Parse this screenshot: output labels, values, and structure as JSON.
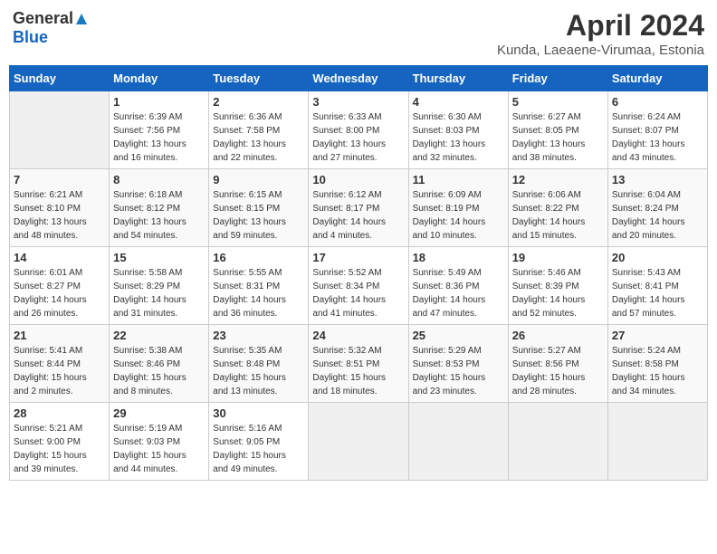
{
  "header": {
    "logo_general": "General",
    "logo_blue": "Blue",
    "month": "April 2024",
    "location": "Kunda, Laeaene-Virumaa, Estonia"
  },
  "days_of_week": [
    "Sunday",
    "Monday",
    "Tuesday",
    "Wednesday",
    "Thursday",
    "Friday",
    "Saturday"
  ],
  "weeks": [
    [
      {
        "day": "",
        "info": ""
      },
      {
        "day": "1",
        "info": "Sunrise: 6:39 AM\nSunset: 7:56 PM\nDaylight: 13 hours\nand 16 minutes."
      },
      {
        "day": "2",
        "info": "Sunrise: 6:36 AM\nSunset: 7:58 PM\nDaylight: 13 hours\nand 22 minutes."
      },
      {
        "day": "3",
        "info": "Sunrise: 6:33 AM\nSunset: 8:00 PM\nDaylight: 13 hours\nand 27 minutes."
      },
      {
        "day": "4",
        "info": "Sunrise: 6:30 AM\nSunset: 8:03 PM\nDaylight: 13 hours\nand 32 minutes."
      },
      {
        "day": "5",
        "info": "Sunrise: 6:27 AM\nSunset: 8:05 PM\nDaylight: 13 hours\nand 38 minutes."
      },
      {
        "day": "6",
        "info": "Sunrise: 6:24 AM\nSunset: 8:07 PM\nDaylight: 13 hours\nand 43 minutes."
      }
    ],
    [
      {
        "day": "7",
        "info": "Sunrise: 6:21 AM\nSunset: 8:10 PM\nDaylight: 13 hours\nand 48 minutes."
      },
      {
        "day": "8",
        "info": "Sunrise: 6:18 AM\nSunset: 8:12 PM\nDaylight: 13 hours\nand 54 minutes."
      },
      {
        "day": "9",
        "info": "Sunrise: 6:15 AM\nSunset: 8:15 PM\nDaylight: 13 hours\nand 59 minutes."
      },
      {
        "day": "10",
        "info": "Sunrise: 6:12 AM\nSunset: 8:17 PM\nDaylight: 14 hours\nand 4 minutes."
      },
      {
        "day": "11",
        "info": "Sunrise: 6:09 AM\nSunset: 8:19 PM\nDaylight: 14 hours\nand 10 minutes."
      },
      {
        "day": "12",
        "info": "Sunrise: 6:06 AM\nSunset: 8:22 PM\nDaylight: 14 hours\nand 15 minutes."
      },
      {
        "day": "13",
        "info": "Sunrise: 6:04 AM\nSunset: 8:24 PM\nDaylight: 14 hours\nand 20 minutes."
      }
    ],
    [
      {
        "day": "14",
        "info": "Sunrise: 6:01 AM\nSunset: 8:27 PM\nDaylight: 14 hours\nand 26 minutes."
      },
      {
        "day": "15",
        "info": "Sunrise: 5:58 AM\nSunset: 8:29 PM\nDaylight: 14 hours\nand 31 minutes."
      },
      {
        "day": "16",
        "info": "Sunrise: 5:55 AM\nSunset: 8:31 PM\nDaylight: 14 hours\nand 36 minutes."
      },
      {
        "day": "17",
        "info": "Sunrise: 5:52 AM\nSunset: 8:34 PM\nDaylight: 14 hours\nand 41 minutes."
      },
      {
        "day": "18",
        "info": "Sunrise: 5:49 AM\nSunset: 8:36 PM\nDaylight: 14 hours\nand 47 minutes."
      },
      {
        "day": "19",
        "info": "Sunrise: 5:46 AM\nSunset: 8:39 PM\nDaylight: 14 hours\nand 52 minutes."
      },
      {
        "day": "20",
        "info": "Sunrise: 5:43 AM\nSunset: 8:41 PM\nDaylight: 14 hours\nand 57 minutes."
      }
    ],
    [
      {
        "day": "21",
        "info": "Sunrise: 5:41 AM\nSunset: 8:44 PM\nDaylight: 15 hours\nand 2 minutes."
      },
      {
        "day": "22",
        "info": "Sunrise: 5:38 AM\nSunset: 8:46 PM\nDaylight: 15 hours\nand 8 minutes."
      },
      {
        "day": "23",
        "info": "Sunrise: 5:35 AM\nSunset: 8:48 PM\nDaylight: 15 hours\nand 13 minutes."
      },
      {
        "day": "24",
        "info": "Sunrise: 5:32 AM\nSunset: 8:51 PM\nDaylight: 15 hours\nand 18 minutes."
      },
      {
        "day": "25",
        "info": "Sunrise: 5:29 AM\nSunset: 8:53 PM\nDaylight: 15 hours\nand 23 minutes."
      },
      {
        "day": "26",
        "info": "Sunrise: 5:27 AM\nSunset: 8:56 PM\nDaylight: 15 hours\nand 28 minutes."
      },
      {
        "day": "27",
        "info": "Sunrise: 5:24 AM\nSunset: 8:58 PM\nDaylight: 15 hours\nand 34 minutes."
      }
    ],
    [
      {
        "day": "28",
        "info": "Sunrise: 5:21 AM\nSunset: 9:00 PM\nDaylight: 15 hours\nand 39 minutes."
      },
      {
        "day": "29",
        "info": "Sunrise: 5:19 AM\nSunset: 9:03 PM\nDaylight: 15 hours\nand 44 minutes."
      },
      {
        "day": "30",
        "info": "Sunrise: 5:16 AM\nSunset: 9:05 PM\nDaylight: 15 hours\nand 49 minutes."
      },
      {
        "day": "",
        "info": ""
      },
      {
        "day": "",
        "info": ""
      },
      {
        "day": "",
        "info": ""
      },
      {
        "day": "",
        "info": ""
      }
    ]
  ]
}
